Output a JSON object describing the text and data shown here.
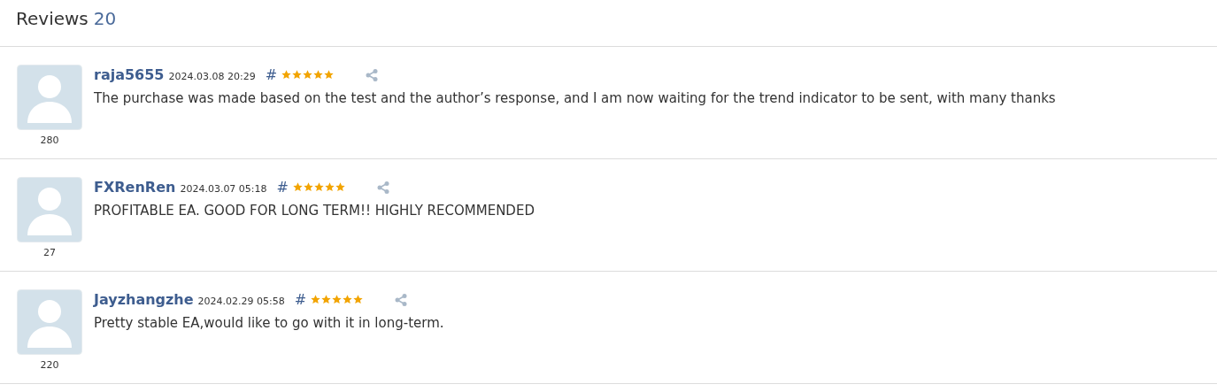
{
  "header": {
    "title": "Reviews",
    "count": "20"
  },
  "reviews": [
    {
      "author": "raja5655",
      "date": "2024.03.08 20:29",
      "hash": "#",
      "stars": 5,
      "text": "The purchase was made based on the test and the author’s response, and I am now waiting for the trend indicator to be sent, with many thanks",
      "rating": "280"
    },
    {
      "author": "FXRenRen",
      "date": "2024.03.07 05:18",
      "hash": "#",
      "stars": 5,
      "text": "PROFITABLE EA. GOOD FOR LONG TERM!! HIGHLY RECOMMENDED",
      "rating": "27"
    },
    {
      "author": "Jayzhangzhe",
      "date": "2024.02.29 05:58",
      "hash": "#",
      "stars": 5,
      "text": "Pretty stable EA,would like to go with it in long-term.",
      "rating": "220"
    }
  ]
}
